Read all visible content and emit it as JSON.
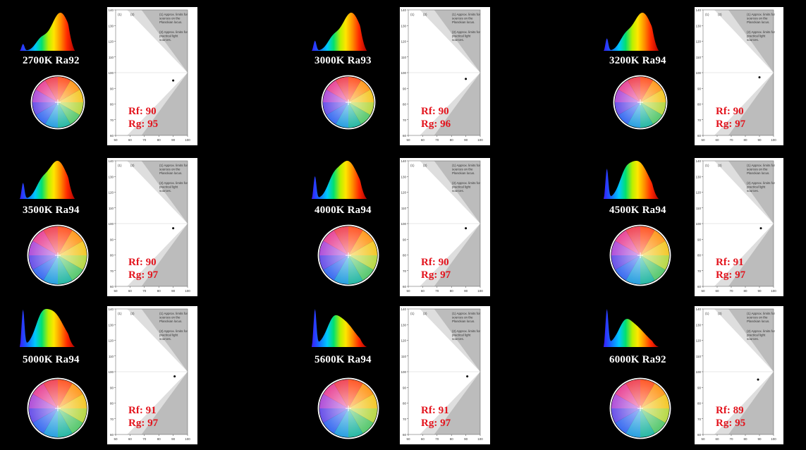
{
  "page": {
    "background": "#000000"
  },
  "panel_text": {
    "legend_1": "(1)",
    "legend_2": "(2)",
    "note_1": [
      "(1) Approx. limits for",
      "sources on the",
      "Planckian locus."
    ],
    "note_2": [
      "(2) Approx. limits for",
      "practical light",
      "sources."
    ],
    "rf_prefix": "Rf:",
    "rg_prefix": "Rg:",
    "cct_suffix": "K",
    "ra_prefix": "Ra"
  },
  "colors": {
    "rf_rg_text": "#e3141d",
    "label_text": "#ffffff",
    "panel_bg": "#ffffff",
    "boundary_gray": "#b4b4b4"
  },
  "chart_data": [
    {
      "type": "scatter",
      "cct": 2700,
      "ra": 92,
      "rf": 90,
      "rg": 95,
      "x": [
        90
      ],
      "y": [
        95
      ],
      "xlim": [
        50,
        100
      ],
      "ylim": [
        60,
        140
      ],
      "xticks": [
        50,
        60,
        70,
        80,
        90,
        100
      ],
      "yticks": [
        60,
        70,
        80,
        90,
        100,
        110,
        120,
        130,
        140
      ],
      "spd_profile": "warm-2700"
    },
    {
      "type": "scatter",
      "cct": 3000,
      "ra": 93,
      "rf": 90,
      "rg": 96,
      "x": [
        90
      ],
      "y": [
        96
      ],
      "xlim": [
        50,
        100
      ],
      "ylim": [
        60,
        140
      ],
      "xticks": [
        50,
        60,
        70,
        80,
        90,
        100
      ],
      "yticks": [
        60,
        70,
        80,
        90,
        100,
        110,
        120,
        130,
        140
      ],
      "spd_profile": "warm-3000"
    },
    {
      "type": "scatter",
      "cct": 3200,
      "ra": 94,
      "rf": 90,
      "rg": 97,
      "x": [
        90
      ],
      "y": [
        97
      ],
      "xlim": [
        50,
        100
      ],
      "ylim": [
        60,
        140
      ],
      "xticks": [
        50,
        60,
        70,
        80,
        90,
        100
      ],
      "yticks": [
        60,
        70,
        80,
        90,
        100,
        110,
        120,
        130,
        140
      ],
      "spd_profile": "warm-3200"
    },
    {
      "type": "scatter",
      "cct": 3500,
      "ra": 94,
      "rf": 90,
      "rg": 97,
      "x": [
        90
      ],
      "y": [
        97
      ],
      "xlim": [
        50,
        100
      ],
      "ylim": [
        60,
        140
      ],
      "xticks": [
        50,
        60,
        70,
        80,
        90,
        100
      ],
      "yticks": [
        60,
        70,
        80,
        90,
        100,
        110,
        120,
        130,
        140
      ],
      "spd_profile": "neutral-3500"
    },
    {
      "type": "scatter",
      "cct": 4000,
      "ra": 94,
      "rf": 90,
      "rg": 97,
      "x": [
        90
      ],
      "y": [
        97
      ],
      "xlim": [
        50,
        100
      ],
      "ylim": [
        60,
        140
      ],
      "xticks": [
        50,
        60,
        70,
        80,
        90,
        100
      ],
      "yticks": [
        60,
        70,
        80,
        90,
        100,
        110,
        120,
        130,
        140
      ],
      "spd_profile": "neutral-4000"
    },
    {
      "type": "scatter",
      "cct": 4500,
      "ra": 94,
      "rf": 91,
      "rg": 97,
      "x": [
        91
      ],
      "y": [
        97
      ],
      "xlim": [
        50,
        100
      ],
      "ylim": [
        60,
        140
      ],
      "xticks": [
        50,
        60,
        70,
        80,
        90,
        100
      ],
      "yticks": [
        60,
        70,
        80,
        90,
        100,
        110,
        120,
        130,
        140
      ],
      "spd_profile": "neutral-4500"
    },
    {
      "type": "scatter",
      "cct": 5000,
      "ra": 94,
      "rf": 91,
      "rg": 97,
      "x": [
        91
      ],
      "y": [
        97
      ],
      "xlim": [
        50,
        100
      ],
      "ylim": [
        60,
        140
      ],
      "xticks": [
        50,
        60,
        70,
        80,
        90,
        100
      ],
      "yticks": [
        60,
        70,
        80,
        90,
        100,
        110,
        120,
        130,
        140
      ],
      "spd_profile": "cool-5000"
    },
    {
      "type": "scatter",
      "cct": 5600,
      "ra": 94,
      "rf": 91,
      "rg": 97,
      "x": [
        91
      ],
      "y": [
        97
      ],
      "xlim": [
        50,
        100
      ],
      "ylim": [
        60,
        140
      ],
      "xticks": [
        50,
        60,
        70,
        80,
        90,
        100
      ],
      "yticks": [
        60,
        70,
        80,
        90,
        100,
        110,
        120,
        130,
        140
      ],
      "spd_profile": "cool-5600"
    },
    {
      "type": "scatter",
      "cct": 6000,
      "ra": 92,
      "rf": 89,
      "rg": 95,
      "x": [
        89
      ],
      "y": [
        95
      ],
      "xlim": [
        50,
        100
      ],
      "ylim": [
        60,
        140
      ],
      "xticks": [
        50,
        60,
        70,
        80,
        90,
        100
      ],
      "yticks": [
        60,
        70,
        80,
        90,
        100,
        110,
        120,
        130,
        140
      ],
      "spd_profile": "cool-6000"
    }
  ]
}
